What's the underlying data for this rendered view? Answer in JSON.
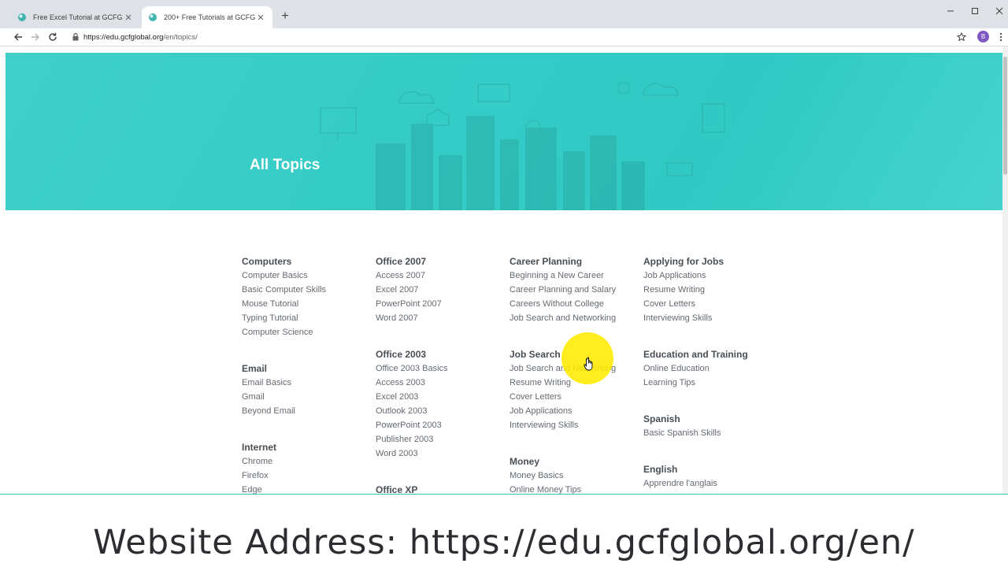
{
  "browser": {
    "tabs": [
      {
        "title": "Free Excel Tutorial at GCFGlobal",
        "active": false
      },
      {
        "title": "200+ Free Tutorials at GCFGlobal",
        "active": true
      }
    ],
    "new_tab_label": "+",
    "url": {
      "host": "https://edu.gcfglobal.org",
      "path": "/en/topics/"
    },
    "profile_initial": "B"
  },
  "hero": {
    "title": "All Topics"
  },
  "columns": [
    [
      {
        "heading": "Computers",
        "links": [
          "Computer Basics",
          "Basic Computer Skills",
          "Mouse Tutorial",
          "Typing Tutorial",
          "Computer Science"
        ]
      },
      {
        "heading": "Email",
        "links": [
          "Email Basics",
          "Gmail",
          "Beyond Email"
        ]
      },
      {
        "heading": "Internet",
        "links": [
          "Chrome",
          "Firefox",
          "Edge"
        ]
      }
    ],
    [
      {
        "heading": "Office 2007",
        "links": [
          "Access 2007",
          "Excel 2007",
          "PowerPoint 2007",
          "Word 2007"
        ]
      },
      {
        "heading": "Office 2003",
        "links": [
          "Office 2003 Basics",
          "Access 2003",
          "Excel 2003",
          "Outlook 2003",
          "PowerPoint 2003",
          "Publisher 2003",
          "Word 2003"
        ]
      },
      {
        "heading": "Office XP",
        "links": []
      }
    ],
    [
      {
        "heading": "Career Planning",
        "links": [
          "Beginning a New Career",
          "Career Planning and Salary",
          "Careers Without College",
          "Job Search and Networking"
        ]
      },
      {
        "heading": "Job Search",
        "links": [
          "Job Search and Networking",
          "Resume Writing",
          "Cover Letters",
          "Job Applications",
          "Interviewing Skills"
        ]
      },
      {
        "heading": "Money",
        "links": [
          "Money Basics",
          "Online Money Tips"
        ]
      }
    ],
    [
      {
        "heading": "Applying for Jobs",
        "links": [
          "Job Applications",
          "Resume Writing",
          "Cover Letters",
          "Interviewing Skills"
        ]
      },
      {
        "heading": "Education and Training",
        "links": [
          "Online Education",
          "Learning Tips"
        ]
      },
      {
        "heading": "Spanish",
        "links": [
          "Basic Spanish Skills"
        ]
      },
      {
        "heading": "English",
        "links": [
          "Apprendre l'anglais"
        ]
      }
    ]
  ],
  "caption": "Website Address: https://edu.gcfglobal.org/en/",
  "colors": {
    "hero": "#34ccc6",
    "heading": "#4a4f55",
    "link": "#646a71",
    "highlight": "#ffeb00"
  }
}
